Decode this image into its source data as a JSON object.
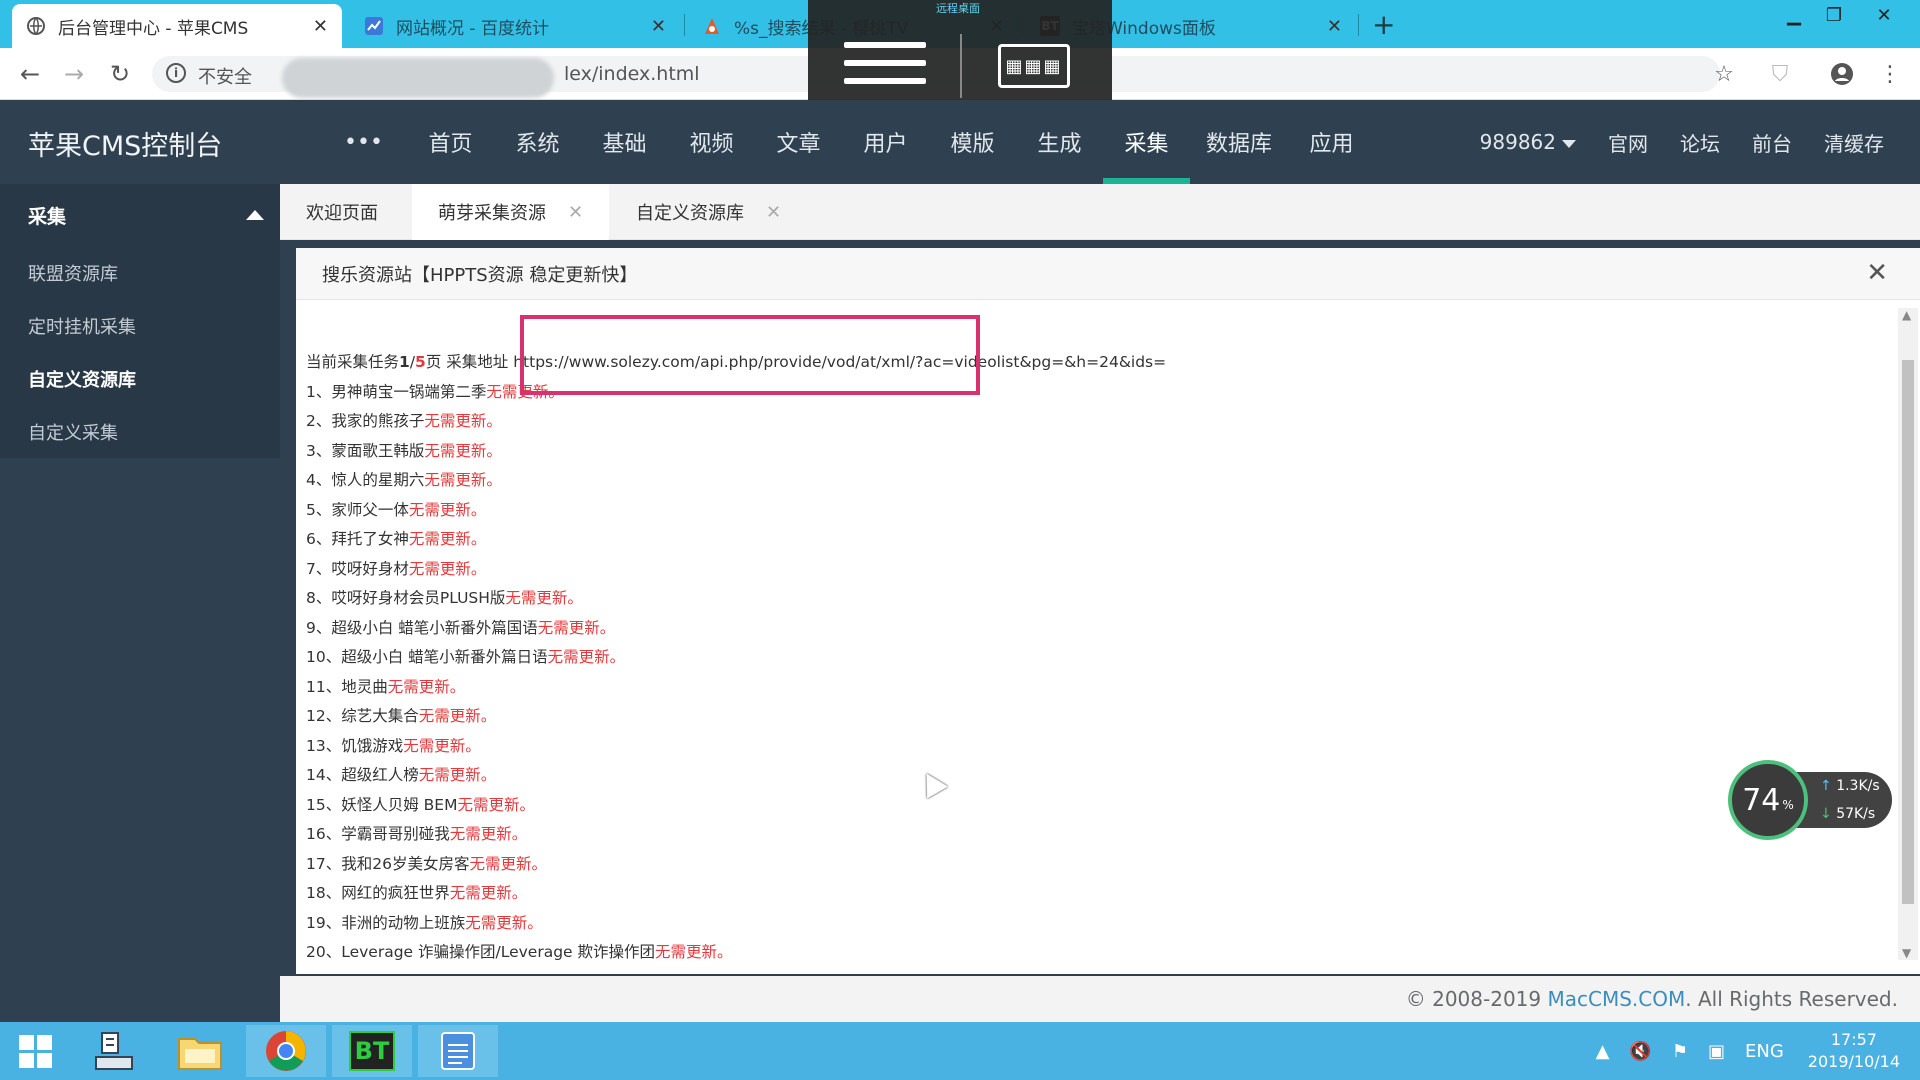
{
  "browser": {
    "tabs": [
      {
        "title": "后台管理中心 - 苹果CMS",
        "active": true
      },
      {
        "title": "网站概况 - 百度统计",
        "active": false
      },
      {
        "title": "%s_搜索结果 - 樱桃TV",
        "active": false
      },
      {
        "title": "宝塔Windows面板",
        "active": false
      }
    ],
    "new_tab": "+",
    "insecure_label": "不安全",
    "url_visible": "lex/index.html"
  },
  "remote_overlay": {
    "label": "远程桌面"
  },
  "cms": {
    "logo": "苹果CMS控制台",
    "nav": [
      "•••",
      "首页",
      "系统",
      "基础",
      "视频",
      "文章",
      "用户",
      "模版",
      "生成",
      "采集",
      "数据库",
      "应用"
    ],
    "active_nav": "采集",
    "user": "989862",
    "right_links": [
      "官网",
      "论坛",
      "前台",
      "清缓存"
    ]
  },
  "sidebar": {
    "section": "采集",
    "items": [
      {
        "label": "联盟资源库",
        "active": false
      },
      {
        "label": "定时挂机采集",
        "active": false
      },
      {
        "label": "自定义资源库",
        "active": true
      },
      {
        "label": "自定义采集",
        "active": false
      }
    ]
  },
  "content_tabs": [
    {
      "label": "欢迎页面",
      "closable": false,
      "active": false
    },
    {
      "label": "萌芽采集资源",
      "closable": true,
      "active": true
    },
    {
      "label": "自定义资源库",
      "closable": true,
      "active": false
    }
  ],
  "panel": {
    "title": "搜乐资源站【HPPTS资源 稳定更新快】",
    "close": "✕"
  },
  "log": {
    "prefix": "当前采集任务",
    "current_page": "1",
    "sep": "/",
    "total_pages": "5",
    "page_suffix": "页 采集地址",
    "url": "https://www.solezy.com/api.php/provide/vod/at/xml/?ac=videolist&pg=&h=24&ids=",
    "status": "无需更新。",
    "items": [
      "1、男神萌宝一锅端第二季",
      "2、我家的熊孩子",
      "3、蒙面歌王韩版",
      "4、惊人的星期六",
      "5、家师父一体",
      "6、拜托了女神",
      "7、哎呀好身材",
      "8、哎呀好身材会员PLUSH版",
      "9、超级小白 蜡笔小新番外篇国语",
      "10、超级小白 蜡笔小新番外篇日语",
      "11、地灵曲",
      "12、综艺大集合",
      "13、饥饿游戏",
      "14、超级红人榜",
      "15、妖怪人贝姆 BEM",
      "16、学霸哥哥别碰我",
      "17、我和26岁美女房客",
      "18、网红的疯狂世界",
      "19、非洲的动物上班族",
      "20、Leverage 诈骗操作团/Leverage 欺诈操作团"
    ]
  },
  "footer": {
    "copyright_prefix": "© 2008-2019 ",
    "brand": "MacCMS.COM",
    "copyright_suffix": ". All Rights Reserved."
  },
  "speed_widget": {
    "percent": "74",
    "unit": "%",
    "upload": "1.3K/s",
    "download": "57K/s"
  },
  "taskbar": {
    "bt_label": "BT",
    "lang": "ENG",
    "time": "17:57",
    "date": "2019/10/14"
  }
}
